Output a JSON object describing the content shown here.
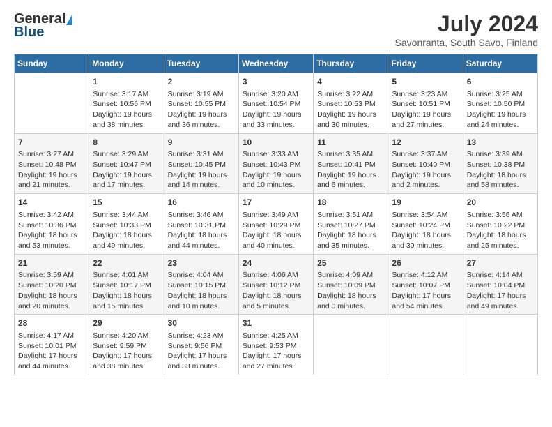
{
  "header": {
    "logo_general": "General",
    "logo_blue": "Blue",
    "month_title": "July 2024",
    "subtitle": "Savonranta, South Savo, Finland"
  },
  "columns": [
    "Sunday",
    "Monday",
    "Tuesday",
    "Wednesday",
    "Thursday",
    "Friday",
    "Saturday"
  ],
  "weeks": [
    [
      {
        "day": "",
        "info": ""
      },
      {
        "day": "1",
        "info": "Sunrise: 3:17 AM\nSunset: 10:56 PM\nDaylight: 19 hours\nand 38 minutes."
      },
      {
        "day": "2",
        "info": "Sunrise: 3:19 AM\nSunset: 10:55 PM\nDaylight: 19 hours\nand 36 minutes."
      },
      {
        "day": "3",
        "info": "Sunrise: 3:20 AM\nSunset: 10:54 PM\nDaylight: 19 hours\nand 33 minutes."
      },
      {
        "day": "4",
        "info": "Sunrise: 3:22 AM\nSunset: 10:53 PM\nDaylight: 19 hours\nand 30 minutes."
      },
      {
        "day": "5",
        "info": "Sunrise: 3:23 AM\nSunset: 10:51 PM\nDaylight: 19 hours\nand 27 minutes."
      },
      {
        "day": "6",
        "info": "Sunrise: 3:25 AM\nSunset: 10:50 PM\nDaylight: 19 hours\nand 24 minutes."
      }
    ],
    [
      {
        "day": "7",
        "info": "Sunrise: 3:27 AM\nSunset: 10:48 PM\nDaylight: 19 hours\nand 21 minutes."
      },
      {
        "day": "8",
        "info": "Sunrise: 3:29 AM\nSunset: 10:47 PM\nDaylight: 19 hours\nand 17 minutes."
      },
      {
        "day": "9",
        "info": "Sunrise: 3:31 AM\nSunset: 10:45 PM\nDaylight: 19 hours\nand 14 minutes."
      },
      {
        "day": "10",
        "info": "Sunrise: 3:33 AM\nSunset: 10:43 PM\nDaylight: 19 hours\nand 10 minutes."
      },
      {
        "day": "11",
        "info": "Sunrise: 3:35 AM\nSunset: 10:41 PM\nDaylight: 19 hours\nand 6 minutes."
      },
      {
        "day": "12",
        "info": "Sunrise: 3:37 AM\nSunset: 10:40 PM\nDaylight: 19 hours\nand 2 minutes."
      },
      {
        "day": "13",
        "info": "Sunrise: 3:39 AM\nSunset: 10:38 PM\nDaylight: 18 hours\nand 58 minutes."
      }
    ],
    [
      {
        "day": "14",
        "info": "Sunrise: 3:42 AM\nSunset: 10:36 PM\nDaylight: 18 hours\nand 53 minutes."
      },
      {
        "day": "15",
        "info": "Sunrise: 3:44 AM\nSunset: 10:33 PM\nDaylight: 18 hours\nand 49 minutes."
      },
      {
        "day": "16",
        "info": "Sunrise: 3:46 AM\nSunset: 10:31 PM\nDaylight: 18 hours\nand 44 minutes."
      },
      {
        "day": "17",
        "info": "Sunrise: 3:49 AM\nSunset: 10:29 PM\nDaylight: 18 hours\nand 40 minutes."
      },
      {
        "day": "18",
        "info": "Sunrise: 3:51 AM\nSunset: 10:27 PM\nDaylight: 18 hours\nand 35 minutes."
      },
      {
        "day": "19",
        "info": "Sunrise: 3:54 AM\nSunset: 10:24 PM\nDaylight: 18 hours\nand 30 minutes."
      },
      {
        "day": "20",
        "info": "Sunrise: 3:56 AM\nSunset: 10:22 PM\nDaylight: 18 hours\nand 25 minutes."
      }
    ],
    [
      {
        "day": "21",
        "info": "Sunrise: 3:59 AM\nSunset: 10:20 PM\nDaylight: 18 hours\nand 20 minutes."
      },
      {
        "day": "22",
        "info": "Sunrise: 4:01 AM\nSunset: 10:17 PM\nDaylight: 18 hours\nand 15 minutes."
      },
      {
        "day": "23",
        "info": "Sunrise: 4:04 AM\nSunset: 10:15 PM\nDaylight: 18 hours\nand 10 minutes."
      },
      {
        "day": "24",
        "info": "Sunrise: 4:06 AM\nSunset: 10:12 PM\nDaylight: 18 hours\nand 5 minutes."
      },
      {
        "day": "25",
        "info": "Sunrise: 4:09 AM\nSunset: 10:09 PM\nDaylight: 18 hours\nand 0 minutes."
      },
      {
        "day": "26",
        "info": "Sunrise: 4:12 AM\nSunset: 10:07 PM\nDaylight: 17 hours\nand 54 minutes."
      },
      {
        "day": "27",
        "info": "Sunrise: 4:14 AM\nSunset: 10:04 PM\nDaylight: 17 hours\nand 49 minutes."
      }
    ],
    [
      {
        "day": "28",
        "info": "Sunrise: 4:17 AM\nSunset: 10:01 PM\nDaylight: 17 hours\nand 44 minutes."
      },
      {
        "day": "29",
        "info": "Sunrise: 4:20 AM\nSunset: 9:59 PM\nDaylight: 17 hours\nand 38 minutes."
      },
      {
        "day": "30",
        "info": "Sunrise: 4:23 AM\nSunset: 9:56 PM\nDaylight: 17 hours\nand 33 minutes."
      },
      {
        "day": "31",
        "info": "Sunrise: 4:25 AM\nSunset: 9:53 PM\nDaylight: 17 hours\nand 27 minutes."
      },
      {
        "day": "",
        "info": ""
      },
      {
        "day": "",
        "info": ""
      },
      {
        "day": "",
        "info": ""
      }
    ]
  ]
}
